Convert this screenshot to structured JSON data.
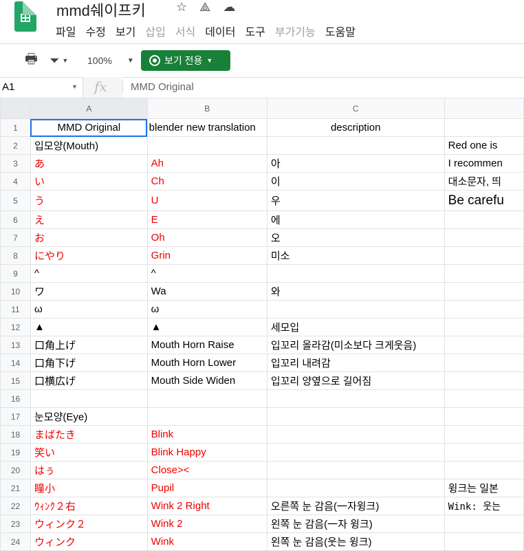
{
  "app": {
    "title": "mmd쉐이프키",
    "menu": [
      {
        "label": "파일",
        "disabled": false
      },
      {
        "label": "수정",
        "disabled": false
      },
      {
        "label": "보기",
        "disabled": false
      },
      {
        "label": "삽입",
        "disabled": true
      },
      {
        "label": "서식",
        "disabled": true
      },
      {
        "label": "데이터",
        "disabled": false
      },
      {
        "label": "도구",
        "disabled": false
      },
      {
        "label": "부가기능",
        "disabled": true
      },
      {
        "label": "도움말",
        "disabled": false
      }
    ]
  },
  "toolbar": {
    "zoom": "100%",
    "view_mode": "보기 전용",
    "accent": "#188038"
  },
  "formula": {
    "cell_ref": "A1",
    "fx": "fx",
    "value": "MMD Original"
  },
  "columns": [
    "A",
    "B",
    "C",
    ""
  ],
  "rows": [
    {
      "n": "1",
      "a": "MMD Original",
      "b": "blender new translation",
      "c": "description",
      "d": "",
      "red": false
    },
    {
      "n": "2",
      "a": "입모양(Mouth)",
      "b": "",
      "c": "",
      "d": "Red one is",
      "red": false
    },
    {
      "n": "3",
      "a": "あ",
      "b": "Ah",
      "c": "아",
      "d": "I recommen",
      "red": true
    },
    {
      "n": "4",
      "a": "い",
      "b": "Ch",
      "c": "이",
      "d": "대소문자, 띄",
      "red": true
    },
    {
      "n": "5",
      "a": "う",
      "b": "U",
      "c": "우",
      "d": "Be carefu",
      "red": true
    },
    {
      "n": "6",
      "a": "え",
      "b": "E",
      "c": "에",
      "d": "",
      "red": true
    },
    {
      "n": "7",
      "a": "お",
      "b": "Oh",
      "c": "오",
      "d": "",
      "red": true
    },
    {
      "n": "8",
      "a": "にやり",
      "b": "Grin",
      "c": "미소",
      "d": "",
      "red": true
    },
    {
      "n": "9",
      "a": "^",
      "b": "^",
      "c": "",
      "d": "",
      "red": false
    },
    {
      "n": "10",
      "a": "ワ",
      "b": "Wa",
      "c": "와",
      "d": "",
      "red": false
    },
    {
      "n": "11",
      "a": "ω",
      "b": "ω",
      "c": "",
      "d": "",
      "red": false
    },
    {
      "n": "12",
      "a": "▲",
      "b": "▲",
      "c": "세모입",
      "d": "",
      "red": false
    },
    {
      "n": "13",
      "a": "口角上げ",
      "b": "Mouth Horn Raise",
      "c": "입꼬리 올라감(미소보다 크게웃음)",
      "d": "",
      "red": false
    },
    {
      "n": "14",
      "a": "口角下げ",
      "b": "Mouth Horn Lower",
      "c": "입꼬리 내려감",
      "d": "",
      "red": false
    },
    {
      "n": "15",
      "a": "口横広げ",
      "b": "Mouth Side Widen",
      "c": "입꼬리 양옆으로 길어짐",
      "d": "",
      "red": false
    },
    {
      "n": "16",
      "a": "",
      "b": "",
      "c": "",
      "d": "",
      "red": false
    },
    {
      "n": "17",
      "a": "눈모양(Eye)",
      "b": "",
      "c": "",
      "d": "",
      "red": false
    },
    {
      "n": "18",
      "a": "まばたき",
      "b": "Blink",
      "c": "",
      "d": "",
      "red": true
    },
    {
      "n": "19",
      "a": "笑い",
      "b": "Blink Happy",
      "c": "",
      "d": "",
      "red": true
    },
    {
      "n": "20",
      "a": "はぅ",
      "b": "Close><",
      "c": "",
      "d": "",
      "red": true
    },
    {
      "n": "21",
      "a": "瞳小",
      "b": "Pupil",
      "c": "",
      "d": "윙크는 일본",
      "red": true
    },
    {
      "n": "22",
      "a": "ｳｨﾝｸ２右",
      "b": "Wink 2 Right",
      "c": "오른쪽 눈 감음(一자윙크)",
      "d": "Wink: 웃는",
      "red": true
    },
    {
      "n": "23",
      "a": "ウィンク２",
      "b": "Wink 2",
      "c": "왼쪽 눈 감음(一자 윙크)",
      "d": "",
      "red": true
    },
    {
      "n": "24",
      "a": "ウィンク",
      "b": "Wink",
      "c": "왼쪽 눈 감음(웃는 윙크)",
      "d": "",
      "red": true
    }
  ]
}
